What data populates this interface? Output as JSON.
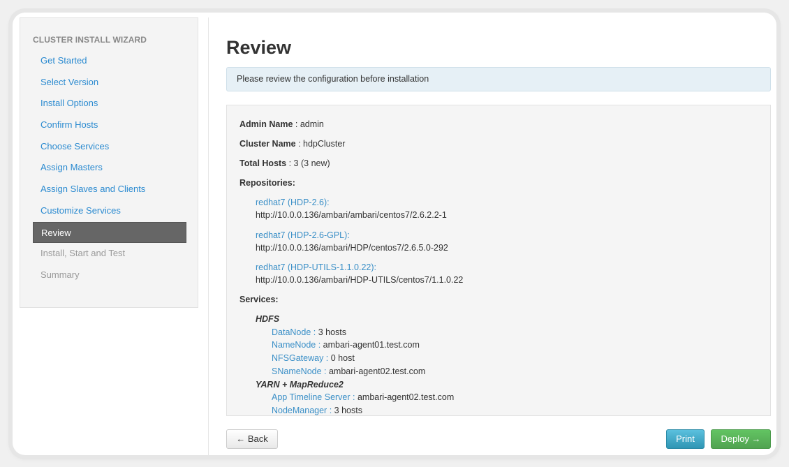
{
  "sidebar": {
    "title": "CLUSTER INSTALL WIZARD",
    "items": [
      {
        "label": "Get Started",
        "state": "done"
      },
      {
        "label": "Select Version",
        "state": "done"
      },
      {
        "label": "Install Options",
        "state": "done"
      },
      {
        "label": "Confirm Hosts",
        "state": "done"
      },
      {
        "label": "Choose Services",
        "state": "done"
      },
      {
        "label": "Assign Masters",
        "state": "done"
      },
      {
        "label": "Assign Slaves and Clients",
        "state": "done"
      },
      {
        "label": "Customize Services",
        "state": "done"
      },
      {
        "label": "Review",
        "state": "active"
      },
      {
        "label": "Install, Start and Test",
        "state": "disabled"
      },
      {
        "label": "Summary",
        "state": "disabled"
      }
    ]
  },
  "main": {
    "title": "Review",
    "info": "Please review the configuration before installation",
    "admin": {
      "label": "Admin Name",
      "value": " : admin"
    },
    "cluster": {
      "label": "Cluster Name",
      "value": " : hdpCluster"
    },
    "hosts": {
      "label": "Total Hosts",
      "value": " : 3 (3 new)"
    },
    "repos_label": "Repositories:",
    "repos": [
      {
        "name": "redhat7 (HDP-2.6):",
        "url": "http://10.0.0.136/ambari/ambari/centos7/2.6.2.2-1"
      },
      {
        "name": "redhat7 (HDP-2.6-GPL):",
        "url": "http://10.0.0.136/ambari/HDP/centos7/2.6.5.0-292"
      },
      {
        "name": "redhat7 (HDP-UTILS-1.1.0.22):",
        "url": "http://10.0.0.136/ambari/HDP-UTILS/centos7/1.1.0.22"
      }
    ],
    "services_label": "Services:",
    "services": [
      {
        "name": "HDFS",
        "components": [
          {
            "name": "DataNode : ",
            "value": "3 hosts"
          },
          {
            "name": "NameNode : ",
            "value": "ambari-agent01.test.com"
          },
          {
            "name": "NFSGateway : ",
            "value": "0 host"
          },
          {
            "name": "SNameNode : ",
            "value": "ambari-agent02.test.com"
          }
        ]
      },
      {
        "name": "YARN + MapReduce2",
        "components": [
          {
            "name": "App Timeline Server : ",
            "value": "ambari-agent02.test.com"
          },
          {
            "name": "NodeManager : ",
            "value": "3 hosts"
          }
        ]
      }
    ]
  },
  "buttons": {
    "back": "← Back",
    "print": "Print",
    "deploy": "Deploy →"
  },
  "colors": {
    "link": "#2a8ad0",
    "print": "#49afcd",
    "deploy": "#5bb75b",
    "active": "#666666"
  }
}
